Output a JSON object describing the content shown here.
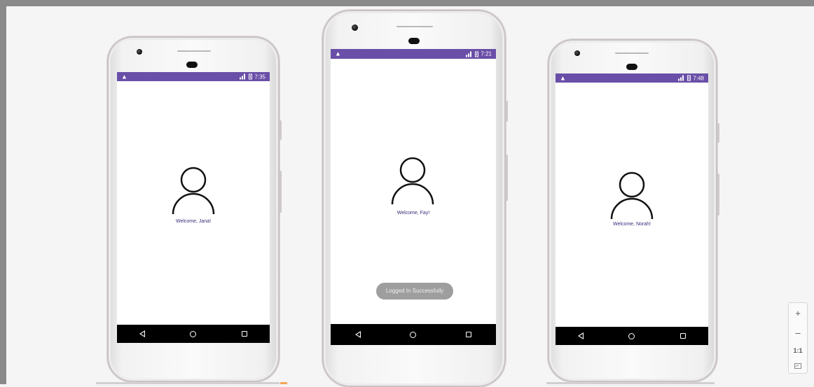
{
  "phones": [
    {
      "id": "phone-left",
      "status_time": "7:35",
      "welcome_text": "Welcome, Jana!",
      "toast": ""
    },
    {
      "id": "phone-center",
      "status_time": "7:21",
      "welcome_text": "Welcome, Fay!",
      "toast": "Logged In Successfully"
    },
    {
      "id": "phone-right",
      "status_time": "7:48",
      "welcome_text": "Welcome, Norah!",
      "toast": ""
    }
  ],
  "status_bar": {
    "warning_icon": "warning-icon",
    "warning_glyph": "▲",
    "signal_icon": "signal-icon",
    "battery_icon": "battery-icon",
    "color": "#6a4fa8"
  },
  "nav_bar": {
    "back_icon": "back-triangle-icon",
    "home_icon": "home-circle-icon",
    "recents_icon": "recents-square-icon"
  },
  "zoom_controls": {
    "zoom_in": "+",
    "zoom_out": "–",
    "actual_size": "1:1",
    "fit_icon": "fit-screen-icon"
  },
  "colors": {
    "accent": "#6a4fa8",
    "welcome_text": "#3b2a7a",
    "toast_bg": "#9e9e9e"
  }
}
